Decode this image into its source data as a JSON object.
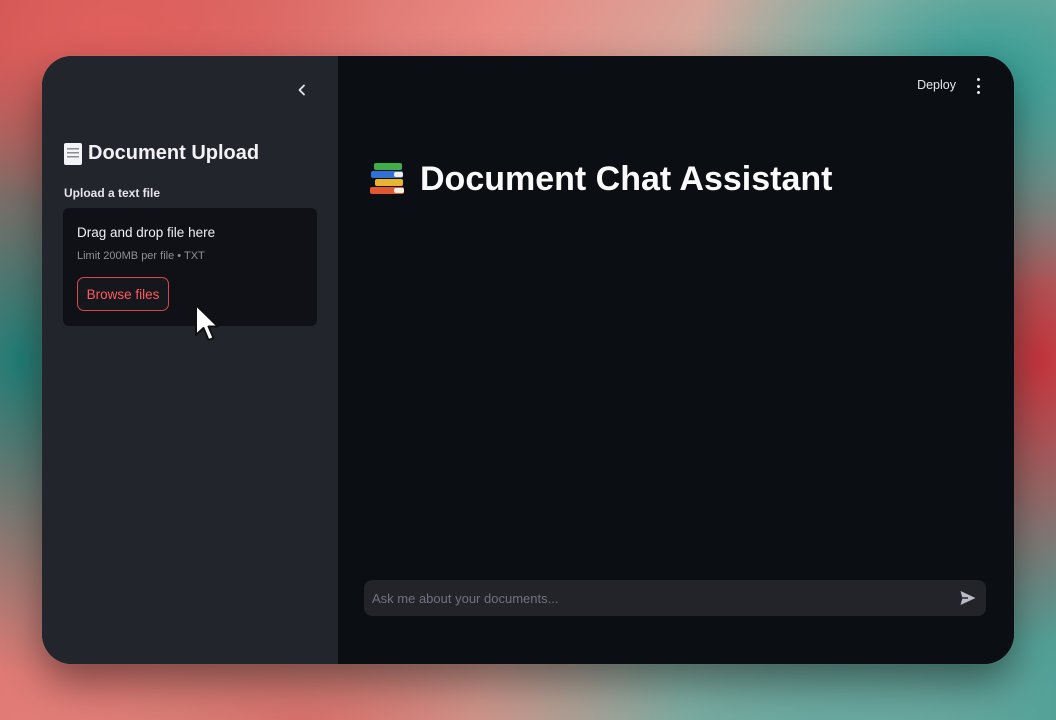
{
  "sidebar": {
    "header_title": "Document Upload",
    "header_icon": "document-icon",
    "collapse_icon": "chevron-left-icon",
    "uploader": {
      "label": "Upload a text file",
      "dropzone_title": "Drag and drop file here",
      "dropzone_limit": "Limit 200MB per file • TXT",
      "browse_label": "Browse files"
    }
  },
  "header": {
    "deploy_label": "Deploy",
    "menu_icon": "more-vertical-icon"
  },
  "main": {
    "title": "Document Chat Assistant",
    "title_icon": "books-icon"
  },
  "chat": {
    "placeholder": "Ask me about your documents...",
    "send_icon": "send-icon"
  },
  "colors": {
    "primary": "#ff4b4b",
    "sidebar_bg": "#23252c",
    "main_bg": "#0b0e12",
    "input_bg": "#22242a"
  }
}
